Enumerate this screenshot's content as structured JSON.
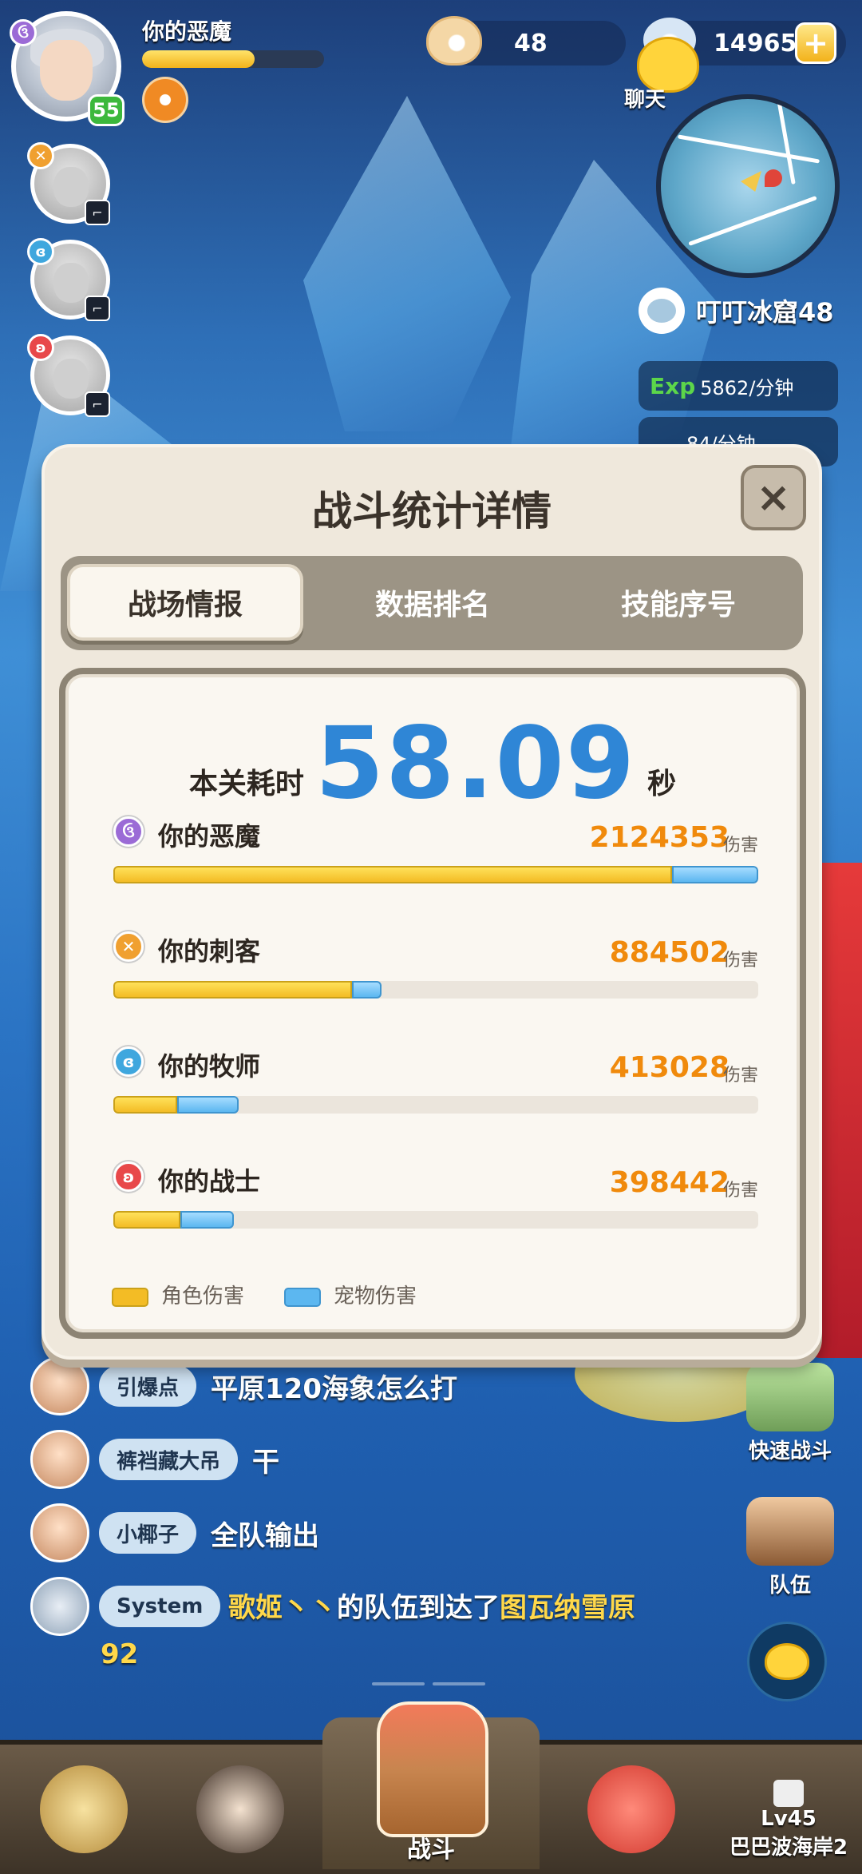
{
  "hud": {
    "player_name": "你的恶魔",
    "level": "55",
    "hp_fraction": 0.62,
    "pearls": "48",
    "coins": "14965",
    "chat_label": "聊天",
    "location": "叮叮冰窟48",
    "exp_prefix": "Exp",
    "exp_rate": "5862/分钟",
    "other_rate": "84/分钟"
  },
  "dialog": {
    "title": "战斗统计详情",
    "close_label": "×",
    "tabs": [
      {
        "label": "战场情报",
        "active": true
      },
      {
        "label": "数据排名",
        "active": false
      },
      {
        "label": "技能序号",
        "active": false
      }
    ],
    "time_label": "本关耗时",
    "time_value": "58.09",
    "time_unit": "秒",
    "damage_unit": "伤害",
    "stats": [
      {
        "name": "你的恶魔",
        "value": "2124353",
        "char_fraction": 0.866,
        "total_fraction": 1.0,
        "color": "#9b6bd6",
        "icon": "demon-class-icon"
      },
      {
        "name": "你的刺客",
        "value": "884502",
        "char_fraction": 0.37,
        "total_fraction": 0.416,
        "color": "#f0a030",
        "icon": "assassin-class-icon"
      },
      {
        "name": "你的牧师",
        "value": "413028",
        "char_fraction": 0.099,
        "total_fraction": 0.194,
        "color": "#3fa7de",
        "icon": "priest-class-icon"
      },
      {
        "name": "你的战士",
        "value": "398442",
        "char_fraction": 0.104,
        "total_fraction": 0.187,
        "color": "#e8484a",
        "icon": "warrior-class-icon"
      }
    ],
    "legend": {
      "character": "角色伤害",
      "pet": "宠物伤害"
    }
  },
  "chat": [
    {
      "name": "引爆点",
      "message": "平原120海象怎么打"
    },
    {
      "name": "裤裆藏大吊",
      "message": "干"
    },
    {
      "name": "小椰子",
      "message": "全队输出"
    }
  ],
  "system_message": {
    "sender": "System",
    "part1": "歌姬丶丶",
    "part2": "的队伍",
    "part3": "到达了",
    "part4": "图瓦纳雪原92"
  },
  "side": {
    "quick_battle": "快速战斗",
    "team": "队伍"
  },
  "nav": {
    "battle": "战斗",
    "locked_level": "Lv45",
    "locked_area": "巴巴波海岸2"
  },
  "colors": {
    "time": "#2f86d6",
    "damage": "#f08a0c",
    "char_bar": "#f3bc25",
    "pet_bar": "#5cb7f0"
  }
}
